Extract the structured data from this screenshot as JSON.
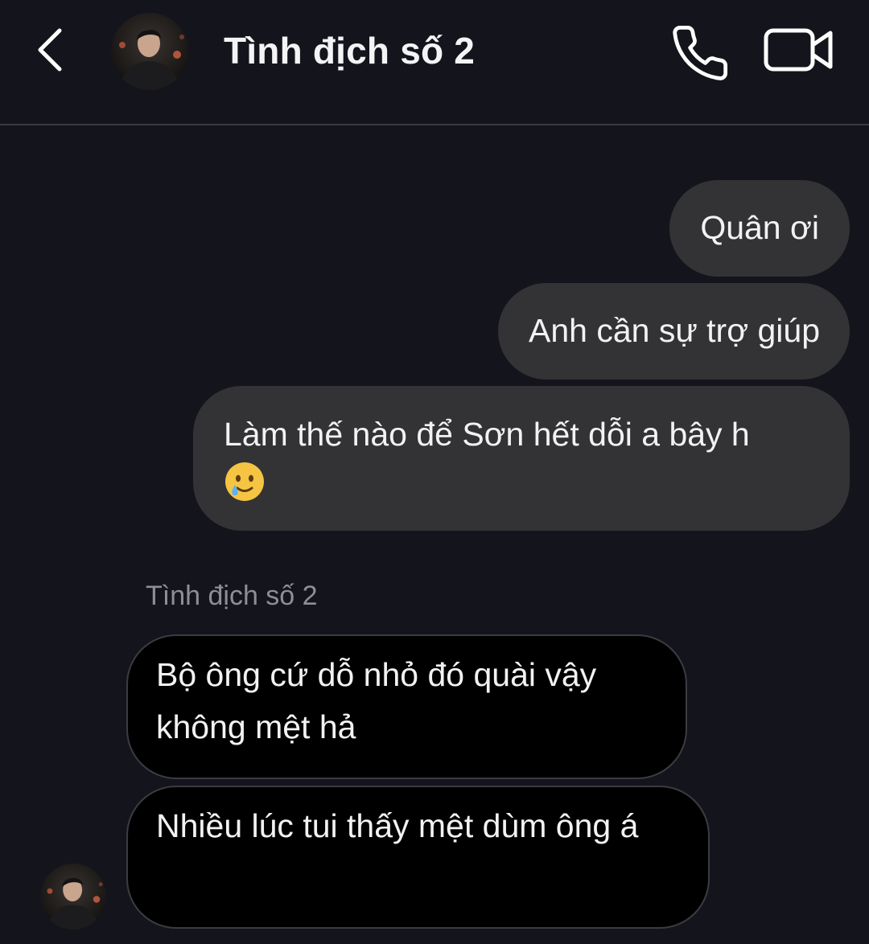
{
  "header": {
    "title": "Tình địch số 2",
    "back_icon": "chevron-left-icon",
    "call_icon": "phone-icon",
    "video_icon": "video-camera-icon"
  },
  "messages": [
    {
      "direction": "outgoing",
      "text": "Quân ơi"
    },
    {
      "direction": "outgoing",
      "text": "Anh cần sự trợ giúp"
    },
    {
      "direction": "outgoing",
      "text": "Làm thế nào để Sơn hết dỗi a bây h",
      "emoji": "smiling-face-with-tear"
    },
    {
      "direction": "incoming",
      "text": "Bộ ông cứ dỗ nhỏ đó quài vậy không mệt hả"
    },
    {
      "direction": "incoming",
      "text": "Nhiều lúc tui thấy mệt dùm ông á"
    }
  ],
  "incoming_sender": "Tình địch số 2",
  "colors": {
    "background": "#14151c",
    "outgoing_bubble": "#333336",
    "incoming_bubble": "#000000",
    "incoming_border": "#3b3c42",
    "sender_label": "#8e8f96"
  }
}
